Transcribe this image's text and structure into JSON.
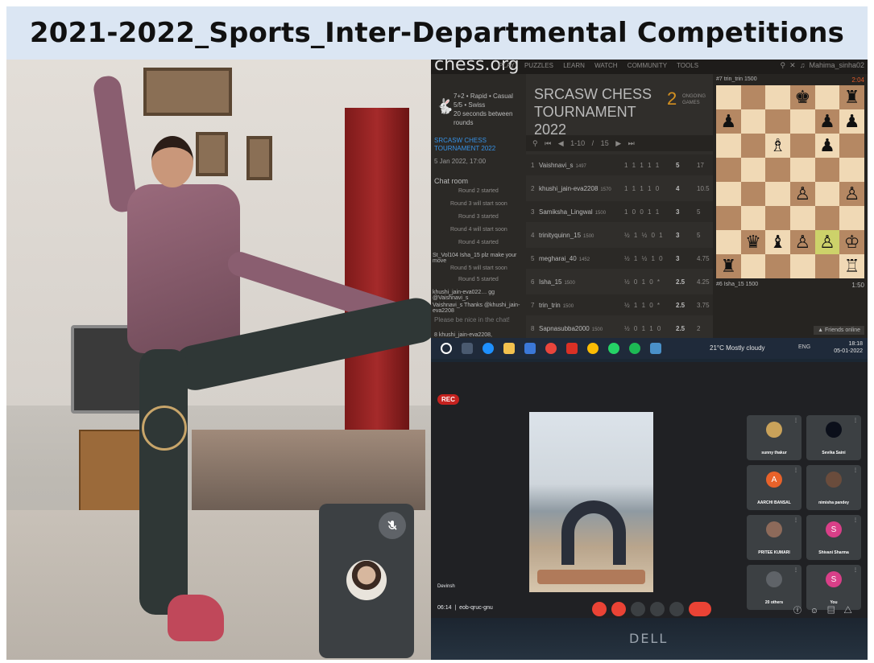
{
  "title": "2021-2022_Sports_Inter-Departmental Competitions",
  "chess": {
    "brand": "chess.org",
    "nav": [
      "PLAY",
      "PUZZLES",
      "LEARN",
      "WATCH",
      "COMMUNITY",
      "TOOLS"
    ],
    "user": "Mahima_sinha02",
    "info_lines": [
      "7+2 • Rapid • Casual",
      "5/5 • Swiss",
      "20 seconds between",
      "rounds"
    ],
    "tournament_link": "SRCASW CHESS TOURNAMENT 2022",
    "tournament_date": "5 Jan 2022, 17:00",
    "chat_title": "Chat room",
    "chat_lines": [
      "Round 2 started",
      "Round 3 will start soon",
      "Round 3 started",
      "Round 4 will start soon",
      "Round 4 started",
      "St_Vol104  Isha_15 plz make your move",
      "Round 5 will start soon",
      "Round 5 started",
      "khushi_jain-eva022…  gg @Vaishnavi_s",
      "Vaishnavi_s  Thanks @khushi_jain-eva2208"
    ],
    "chat_note": "Please be nice in the chat!",
    "chat_players": "8  khushi_jain-eva2208, Mahima_sinha02, trinityquinn_15,",
    "tournament_name": "SRCASW CHESS TOURNAMENT 2022",
    "ongoing_count": "2",
    "ongoing_label": "ONGOING GAMES",
    "pager": "1-10 / 15",
    "standings": [
      {
        "rank": "1",
        "name": "Vaishnavi_s",
        "rating": "1497",
        "points": "1 1 1 1 1",
        "score": "5",
        "tb": "17"
      },
      {
        "rank": "2",
        "name": "khushi_jain-eva2208",
        "rating": "1570",
        "points": "1 1 1 1 0",
        "score": "4",
        "tb": "10.5"
      },
      {
        "rank": "3",
        "name": "Samiksha_Lingwal",
        "rating": "1500",
        "points": "1 0 0 1 1",
        "score": "3",
        "tb": "5"
      },
      {
        "rank": "4",
        "name": "trinityquinn_15",
        "rating": "1500",
        "points": "½ 1 ½ 0 1",
        "score": "3",
        "tb": "5"
      },
      {
        "rank": "5",
        "name": "megharai_40",
        "rating": "1452",
        "points": "½ 1 ½ 1 0",
        "score": "3",
        "tb": "4.75"
      },
      {
        "rank": "6",
        "name": "Isha_15",
        "rating": "1500",
        "points": "½ 0 1 0 *",
        "score": "2.5",
        "tb": "4.25"
      },
      {
        "rank": "7",
        "name": "trin_trin",
        "rating": "1500",
        "points": "½ 1 1 0 *",
        "score": "2.5",
        "tb": "3.75"
      },
      {
        "rank": "8",
        "name": "Sapnasubba2000",
        "rating": "1500",
        "points": "½ 0 1 1 0",
        "score": "2.5",
        "tb": "2"
      }
    ],
    "player_top": "#7 trin_trin  1500",
    "clock_top": "2:04",
    "player_bottom": "#6 Isha_15  1500",
    "clock_bottom": "1:50",
    "board": [
      [
        "",
        "",
        "",
        "♚",
        "",
        "♜"
      ],
      [
        "♟",
        "",
        "",
        "",
        "♟",
        "♟"
      ],
      [
        "",
        "",
        "♗",
        "",
        "♟",
        ""
      ],
      [
        "",
        "",
        "",
        "",
        "",
        ""
      ],
      [
        "",
        "",
        "",
        "♙",
        "",
        "♙"
      ],
      [
        "",
        "",
        "",
        "",
        "",
        ""
      ],
      [
        "",
        "♛",
        "♝",
        "♙",
        "♙",
        "♔"
      ],
      [
        "♜",
        "",
        "",
        "",
        "",
        "♖"
      ]
    ],
    "friends": "▲ Friends online"
  },
  "taskbar": {
    "weather": "21°C  Mostly cloudy",
    "lang": "ENG",
    "time": "18:18",
    "date": "05-01-2022"
  },
  "meet": {
    "rec": "REC",
    "tiles": [
      {
        "name": "sunny thakur",
        "initial": "",
        "color": "#c9a25a"
      },
      {
        "name": "Sevika Saini",
        "initial": "",
        "color": "#0b0f1a"
      },
      {
        "name": "AARCHI BANSAL",
        "initial": "A",
        "color": "#e8622a"
      },
      {
        "name": "nimisha pandey",
        "initial": "",
        "color": "#6a4c3c"
      },
      {
        "name": "PRITEE KUMARI",
        "initial": "",
        "color": "#8d6a5a"
      },
      {
        "name": "Shivani Sharma",
        "initial": "S",
        "color": "#d93f88"
      },
      {
        "name": "20 others",
        "initial": "",
        "color": "#5f6368"
      },
      {
        "name": "You",
        "initial": "S",
        "color": "#d93f88"
      }
    ],
    "own_name": "Devinsh",
    "meeting_time": "06:14",
    "meeting_code": "eob-qruc-gnu",
    "brand": "DELL"
  }
}
